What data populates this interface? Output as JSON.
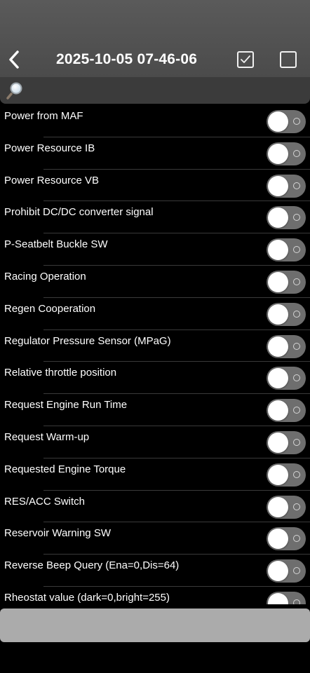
{
  "header": {
    "title": "2025-10-05 07-46-06"
  },
  "search": {
    "value": "",
    "placeholder": ""
  },
  "rows": [
    {
      "label": "Power from MAF",
      "on": false
    },
    {
      "label": "Power Resource IB",
      "on": false
    },
    {
      "label": "Power Resource VB",
      "on": false
    },
    {
      "label": "Prohibit DC/DC converter signal",
      "on": false
    },
    {
      "label": "P-Seatbelt Buckle SW",
      "on": false
    },
    {
      "label": "Racing Operation",
      "on": false
    },
    {
      "label": "Regen Cooperation",
      "on": false
    },
    {
      "label": "Regulator Pressure Sensor (MPaG)",
      "on": false
    },
    {
      "label": "Relative throttle position",
      "on": false
    },
    {
      "label": "Request Engine Run Time",
      "on": false
    },
    {
      "label": "Request Warm-up",
      "on": false
    },
    {
      "label": "Requested Engine Torque",
      "on": false
    },
    {
      "label": "RES/ACC Switch",
      "on": false
    },
    {
      "label": "Reservoir Warning SW",
      "on": false
    },
    {
      "label": "Reverse Beep Query (Ena=0,Dis=64)",
      "on": false
    },
    {
      "label": "Rheostat value (dark=0,bright=255)",
      "on": false
    }
  ],
  "bottom_button": {
    "label": ""
  },
  "colors": {
    "header_bg": "#555555",
    "search_bg": "#3b3b3b",
    "list_bg": "#000000",
    "toggle_off_track": "#6e6e6e",
    "bottom_button_bg": "#ababab"
  },
  "icons": {
    "back": "chevron-left-icon",
    "check_all": "checkbox-checked-icon",
    "uncheck_all": "checkbox-empty-icon",
    "search": "magnifier-icon"
  }
}
